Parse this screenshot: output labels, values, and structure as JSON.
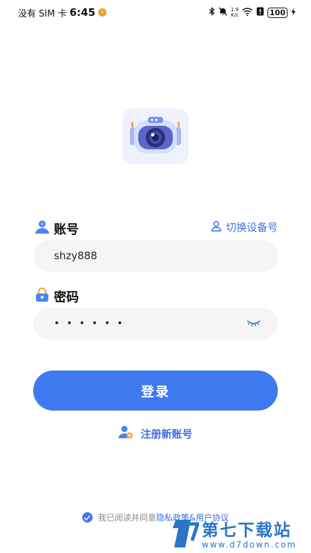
{
  "status_bar": {
    "carrier": "没有 SIM 卡",
    "time": "6:45",
    "net_speed_value": "1.9",
    "net_speed_unit": "K/s",
    "battery": "100"
  },
  "account": {
    "label": "账号",
    "value": "shzy888",
    "switch_link": "切换设备号"
  },
  "password": {
    "label": "密码",
    "masked_value": "••••••"
  },
  "login_button": "登录",
  "register_link": "注册新账号",
  "agreement": {
    "text": "我已阅读并同意",
    "link": "隐私政策&用户协议",
    "checked": true
  },
  "watermark": {
    "title": "第七下载站",
    "url": "www.d7down.com"
  },
  "colors": {
    "accent": "#3f79f0",
    "link": "#3c6fe0",
    "input_bg": "#f5f5f5"
  }
}
